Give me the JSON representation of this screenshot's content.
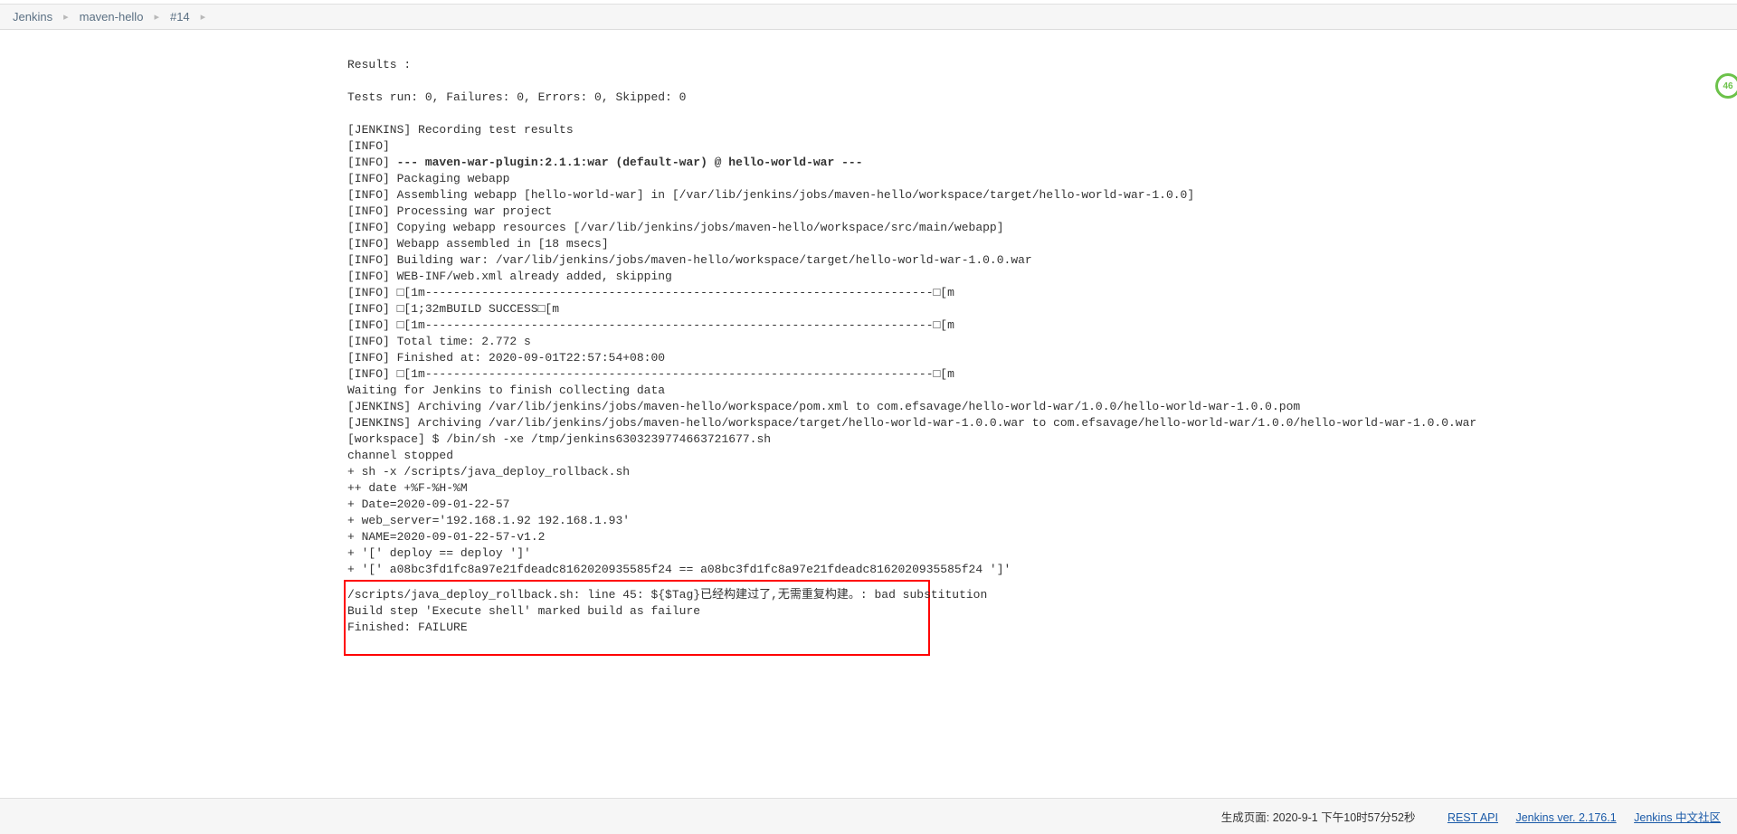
{
  "breadcrumb": {
    "items": [
      {
        "label": "Jenkins"
      },
      {
        "label": "maven-hello"
      },
      {
        "label": "#14"
      }
    ]
  },
  "badge": {
    "count": "46"
  },
  "console": {
    "lines": [
      "",
      "Results :",
      "",
      "Tests run: 0, Failures: 0, Errors: 0, Skipped: 0",
      "",
      "[JENKINS] Recording test results",
      "[INFO] ",
      {
        "prefix": "[INFO] ",
        "bold": "--- maven-war-plugin:2.1.1:war (default-war) @ hello-world-war ---"
      },
      "[INFO] Packaging webapp",
      "[INFO] Assembling webapp [hello-world-war] in [/var/lib/jenkins/jobs/maven-hello/workspace/target/hello-world-war-1.0.0]",
      "[INFO] Processing war project",
      "[INFO] Copying webapp resources [/var/lib/jenkins/jobs/maven-hello/workspace/src/main/webapp]",
      "[INFO] Webapp assembled in [18 msecs]",
      "[INFO] Building war: /var/lib/jenkins/jobs/maven-hello/workspace/target/hello-world-war-1.0.0.war",
      "[INFO] WEB-INF/web.xml already added, skipping",
      "[INFO] □[1m------------------------------------------------------------------------□[m",
      "[INFO] □[1;32mBUILD SUCCESS□[m",
      "[INFO] □[1m------------------------------------------------------------------------□[m",
      "[INFO] Total time: 2.772 s",
      "[INFO] Finished at: 2020-09-01T22:57:54+08:00",
      "[INFO] □[1m------------------------------------------------------------------------□[m",
      "Waiting for Jenkins to finish collecting data",
      "[JENKINS] Archiving /var/lib/jenkins/jobs/maven-hello/workspace/pom.xml to com.efsavage/hello-world-war/1.0.0/hello-world-war-1.0.0.pom",
      "[JENKINS] Archiving /var/lib/jenkins/jobs/maven-hello/workspace/target/hello-world-war-1.0.0.war to com.efsavage/hello-world-war/1.0.0/hello-world-war-1.0.0.war",
      "[workspace] $ /bin/sh -xe /tmp/jenkins6303239774663721677.sh",
      "channel stopped",
      "+ sh -x /scripts/java_deploy_rollback.sh",
      "++ date +%F-%H-%M",
      "+ Date=2020-09-01-22-57",
      "+ web_server='192.168.1.92 192.168.1.93'",
      "+ NAME=2020-09-01-22-57-v1.2",
      "+ '[' deploy == deploy ']'",
      "+ '[' a08bc3fd1fc8a97e21fdeadc8162020935585f24 == a08bc3fd1fc8a97e21fdeadc8162020935585f24 ']'"
    ],
    "highlighted": [
      "/scripts/java_deploy_rollback.sh: line 45: ${$Tag}已经构建过了,无需重复构建。: bad substitution",
      "Build step 'Execute shell' marked build as failure",
      "Finished: FAILURE"
    ]
  },
  "footer": {
    "generated": "生成页面: 2020-9-1 下午10时57分52秒",
    "links": [
      {
        "label": "REST API"
      },
      {
        "label": "Jenkins ver. 2.176.1"
      },
      {
        "label": "Jenkins 中文社区"
      }
    ]
  }
}
